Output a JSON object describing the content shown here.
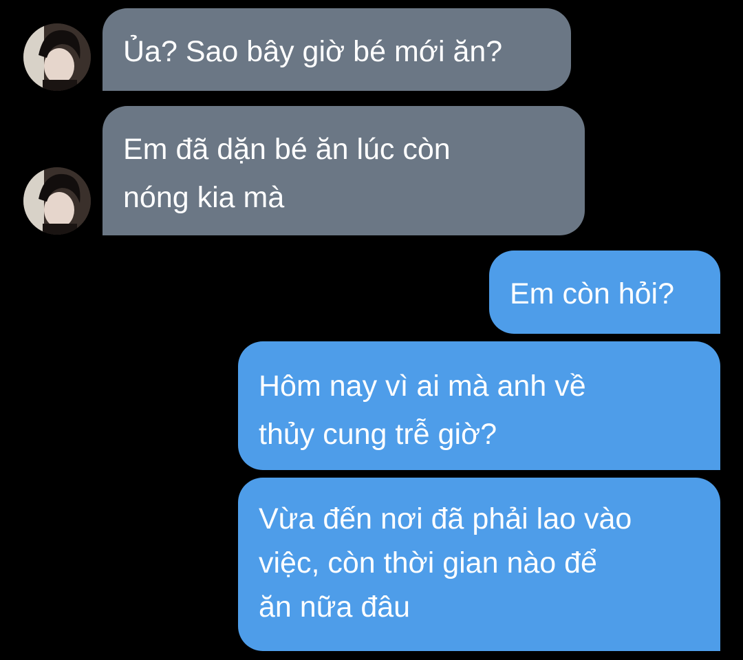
{
  "conversation": {
    "messages": [
      {
        "direction": "incoming",
        "text": "Ủa? Sao bây giờ bé mới ăn?"
      },
      {
        "direction": "incoming",
        "text": "Em đã dặn bé ăn lúc còn\nnóng kia mà"
      },
      {
        "direction": "outgoing",
        "text": "Em còn hỏi?"
      },
      {
        "direction": "outgoing",
        "text": "Hôm nay vì ai mà anh về\nthủy cung trễ giờ?"
      },
      {
        "direction": "outgoing",
        "text": "Vừa đến nơi đã phải lao vào\nviệc, còn thời gian nào để\năn nữa đâu"
      }
    ]
  },
  "colors": {
    "background": "#000000",
    "incoming_bubble": "#6b7785",
    "outgoing_bubble": "#4e9de9",
    "text": "#ffffff"
  },
  "icons": {
    "avatar": "contact-avatar-photo"
  }
}
